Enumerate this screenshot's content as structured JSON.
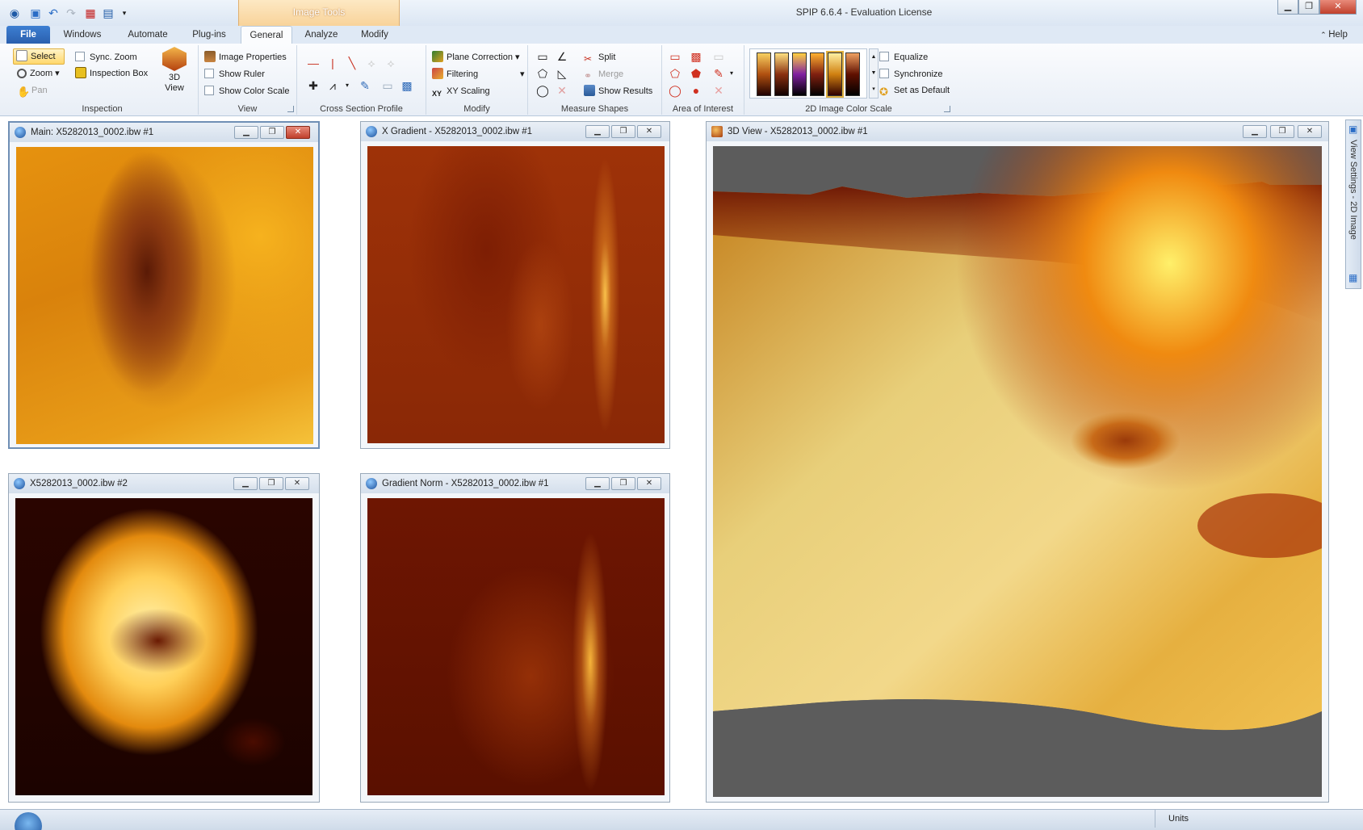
{
  "app": {
    "title": "SPIP 6.6.4 - Evaluation License",
    "contextual_tab": "Image Tools",
    "help_label": "Help"
  },
  "tabs": [
    "File",
    "Windows",
    "Automate",
    "Plug-ins",
    "General",
    "Analyze",
    "Modify"
  ],
  "active_tab": "General",
  "ribbon": {
    "inspection": {
      "label": "Inspection",
      "select": "Select",
      "zoom": "Zoom",
      "pan": "Pan",
      "sync_zoom": "Sync. Zoom",
      "inspection_box": "Inspection Box",
      "view_3d": "3D View"
    },
    "view": {
      "label": "View",
      "image_properties": "Image Properties",
      "show_ruler": "Show Ruler",
      "show_color_scale": "Show Color Scale"
    },
    "cross_section": {
      "label": "Cross Section Profile"
    },
    "modify": {
      "label": "Modify",
      "plane_correction": "Plane Correction",
      "filtering": "Filtering",
      "xy_scaling": "XY Scaling"
    },
    "measure": {
      "label": "Measure Shapes",
      "split": "Split",
      "merge": "Merge",
      "show_results": "Show Results"
    },
    "aoi": {
      "label": "Area of Interest"
    },
    "color_scale": {
      "label": "2D Image Color Scale",
      "equalize": "Equalize",
      "synchronize": "Synchronize",
      "set_default": "Set as Default"
    }
  },
  "windows": {
    "main": {
      "title": "Main: X5282013_0002.ibw #1"
    },
    "xgrad": {
      "title": "X Gradient - X5282013_0002.ibw #1"
    },
    "img2": {
      "title": "X5282013_0002.ibw #2"
    },
    "gnorm": {
      "title": "Gradient Norm - X5282013_0002.ibw #1"
    },
    "view3d": {
      "title": "3D View - X5282013_0002.ibw #1"
    }
  },
  "side_panel": {
    "label": "View Settings - 2D Image"
  },
  "status": {
    "units_label": "Units"
  },
  "colors": {
    "accent": "#2a5fae",
    "contextual": "#f8d39a",
    "heat_dark": "#3a0800",
    "heat_light": "#ffe89a"
  }
}
